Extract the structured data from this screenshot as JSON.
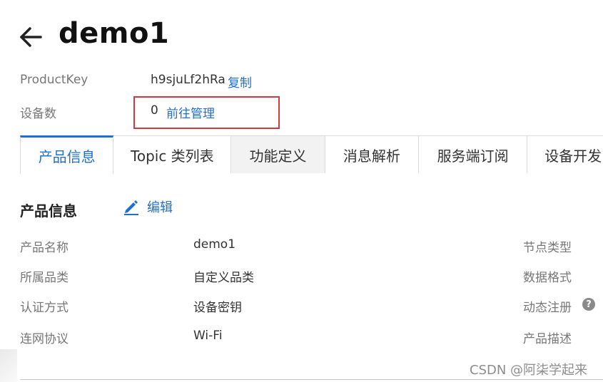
{
  "header": {
    "title": "demo1"
  },
  "product_meta": {
    "product_key_label": "ProductKey",
    "product_key_value": "h9sjuLf2hRa",
    "copy_label": "复制",
    "device_count_label": "设备数",
    "device_count_value": "0",
    "manage_link": "前往管理"
  },
  "tabs": [
    {
      "label": "产品信息",
      "active": true
    },
    {
      "label": "Topic 类列表",
      "active": false
    },
    {
      "label": "功能定义",
      "active": false
    },
    {
      "label": "消息解析",
      "active": false
    },
    {
      "label": "服务端订阅",
      "active": false
    },
    {
      "label": "设备开发",
      "active": false
    }
  ],
  "info_section": {
    "title": "产品信息",
    "edit_label": "编辑",
    "rows": [
      {
        "label": "产品名称",
        "value": "demo1"
      },
      {
        "label": "所属品类",
        "value": "自定义品类"
      },
      {
        "label": "认证方式",
        "value": "设备密钥"
      },
      {
        "label": "连网协议",
        "value": "Wi-Fi"
      }
    ],
    "right_labels": [
      "节点类型",
      "数据格式",
      "动态注册",
      "产品描述"
    ],
    "help_symbol": "?"
  },
  "icons": {
    "back": "arrow-left-icon",
    "edit": "pencil-icon",
    "help": "question-circle-icon"
  },
  "colors": {
    "accent": "#1e6fcf",
    "highlight_box": "#d0393e"
  },
  "watermark": "CSDN @阿柒学起来"
}
